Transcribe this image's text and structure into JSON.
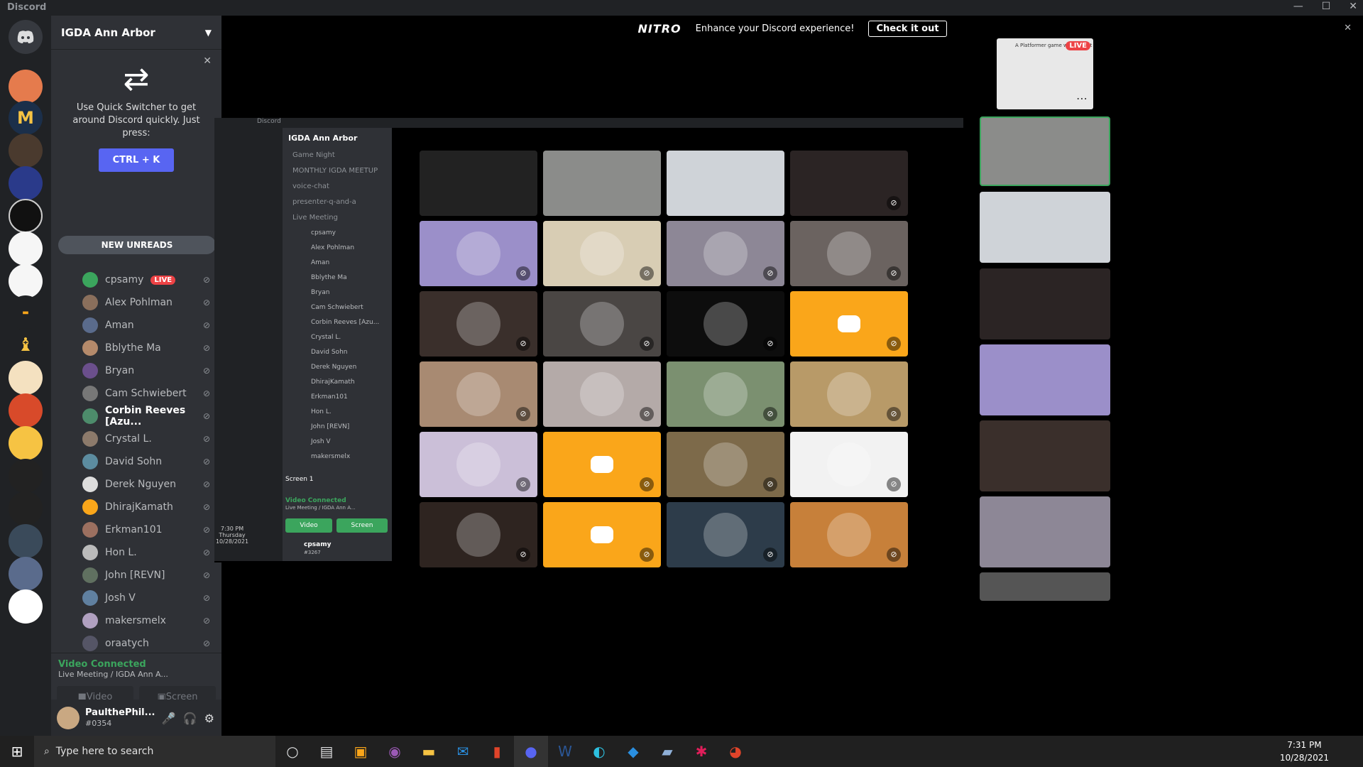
{
  "window": {
    "title": "Discord"
  },
  "nitro": {
    "brand": "NITRO",
    "message": "Enhance your Discord experience!",
    "cta": "Check it out"
  },
  "server": {
    "name": "IGDA Ann Arbor"
  },
  "quick_switcher": {
    "text": "Use Quick Switcher to get around Discord quickly. Just press:",
    "shortcut": "CTRL + K"
  },
  "unreads": {
    "label": "NEW UNREADS"
  },
  "members": [
    {
      "name": "cpsamy",
      "live": "LIVE",
      "color": "#3ba55d"
    },
    {
      "name": "Alex Pohlman",
      "color": "#8a6f5c"
    },
    {
      "name": "Aman",
      "color": "#5a6b8c"
    },
    {
      "name": "Bblythe Ma",
      "color": "#b58a6b"
    },
    {
      "name": "Bryan",
      "color": "#6b4f8c"
    },
    {
      "name": "Cam Schwiebert",
      "color": "#777"
    },
    {
      "name": "Corbin Reeves [Azu...",
      "bold": true,
      "color": "#4d8c6b"
    },
    {
      "name": "Crystal L.",
      "color": "#8c7a6b"
    },
    {
      "name": "David Sohn",
      "color": "#5c8ca0"
    },
    {
      "name": "Derek Nguyen",
      "color": "#ddd"
    },
    {
      "name": "DhirajKamath",
      "color": "#faa61a"
    },
    {
      "name": "Erkman101",
      "color": "#9c7060"
    },
    {
      "name": "Hon L.",
      "color": "#bbb"
    },
    {
      "name": "John [REVN]",
      "color": "#607060"
    },
    {
      "name": "Josh V",
      "color": "#6080a0"
    },
    {
      "name": "makersmelx",
      "color": "#b0a0c0"
    },
    {
      "name": "oraatych",
      "color": "#556"
    }
  ],
  "voice": {
    "status": "Video Connected",
    "sub": "Live Meeting / IGDA Ann A...",
    "video": "Video",
    "screen": "Screen"
  },
  "user": {
    "name": "PaulthePhil...",
    "tag": "#0354"
  },
  "inner_discord": {
    "title": "Discord",
    "server": "IGDA Ann Arbor",
    "channels": [
      "Game Night",
      "MONTHLY IGDA MEETUP",
      "voice-chat",
      "presenter-q-and-a",
      "Live Meeting"
    ],
    "members": [
      "cpsamy",
      "Alex Pohlman",
      "Aman",
      "Bblythe Ma",
      "Bryan",
      "Cam Schwiebert",
      "Corbin Reeves [Azu...",
      "Crystal L.",
      "David Sohn",
      "Derek Nguyen",
      "DhirajKamath",
      "Erkman101",
      "Hon L.",
      "John [REVN]",
      "Josh V",
      "makersmelx"
    ],
    "screen_label": "Screen 1",
    "voice_status": "Video Connected",
    "voice_sub": "Live Meeting / IGDA Ann A...",
    "video": "Video",
    "screen": "Screen",
    "user": "cpsamy",
    "user_tag": "#3267",
    "clock": "7:30 PM",
    "day": "Thursday",
    "date": "10/28/2021"
  },
  "live_badge": "LIVE",
  "preview_title": "A Platformer game with a twist",
  "taskbar": {
    "search_placeholder": "Type here to search",
    "time": "7:31 PM",
    "date": "10/28/2021"
  }
}
